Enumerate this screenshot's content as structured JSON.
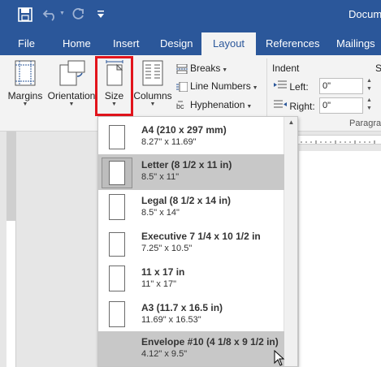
{
  "app": {
    "title": "Docume"
  },
  "quick_access": {
    "save_icon": "save-icon",
    "undo_icon": "undo-icon",
    "redo_icon": "redo-icon",
    "customize_icon": "customize-toolbar-icon"
  },
  "tabs": [
    {
      "label": "File"
    },
    {
      "label": "Home"
    },
    {
      "label": "Insert"
    },
    {
      "label": "Design"
    },
    {
      "label": "Layout"
    },
    {
      "label": "References"
    },
    {
      "label": "Mailings"
    }
  ],
  "active_tab": "Layout",
  "ribbon": {
    "margins": "Margins",
    "orientation": "Orientation",
    "size": "Size",
    "columns": "Columns",
    "breaks": "Breaks",
    "line_numbers": "Line Numbers",
    "hyphenation": "Hyphenation",
    "indent_title": "Indent",
    "left_label": "Left:",
    "right_label": "Right:",
    "left_value": "0\"",
    "right_value": "0\"",
    "paragraph_group": "Paragra",
    "spacing_partial": "S"
  },
  "size_menu": {
    "items": [
      {
        "name": "A4 (210 x 297 mm)",
        "dims": "8.27\" x 11.69\""
      },
      {
        "name": "Letter (8 1/2 x 11 in)",
        "dims": "8.5\" x 11\""
      },
      {
        "name": "Legal (8 1/2 x 14 in)",
        "dims": "8.5\" x 14\""
      },
      {
        "name": "Executive 7 1/4 x 10 1/2 in",
        "dims": "7.25\" x 10.5\""
      },
      {
        "name": "11 x 17 in",
        "dims": "11\" x 17\""
      },
      {
        "name": "A3 (11.7 x 16.5 in)",
        "dims": "11.69\" x 16.53\""
      },
      {
        "name": "Envelope #10 (4 1/8 x 9 1/2 in)",
        "dims": "4.12\" x 9.5\""
      }
    ],
    "selected": "Letter (8 1/2 x 11 in)",
    "hovered": "Envelope #10 (4 1/8 x 9 1/2 in)"
  },
  "colors": {
    "brand": "#2b579a",
    "highlight_border": "#e2141c"
  }
}
